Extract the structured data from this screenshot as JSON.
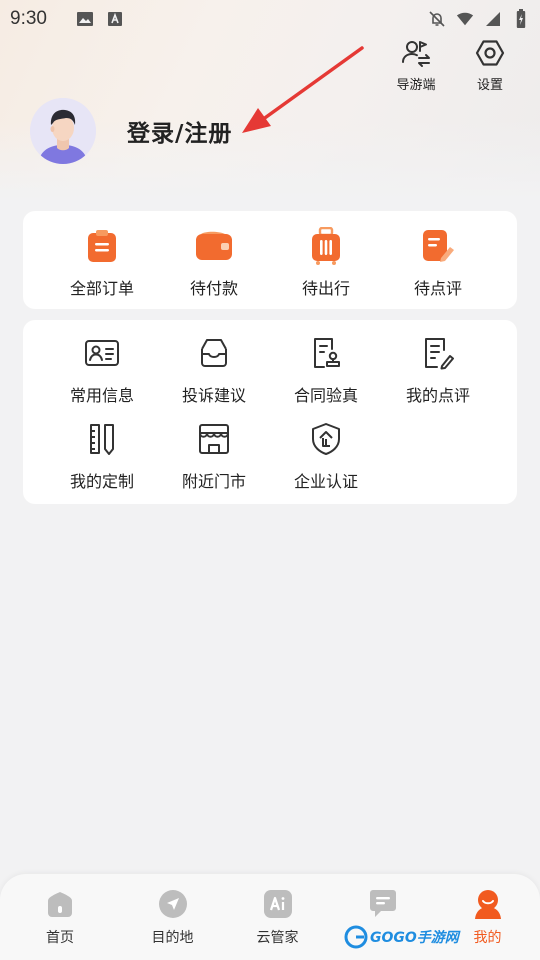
{
  "status_bar": {
    "time": "9:30",
    "left_icons": [
      "image-icon",
      "text-a-icon"
    ],
    "right_icons": [
      "bell-off-icon",
      "wifi-icon",
      "signal-icon",
      "battery-icon"
    ]
  },
  "top_actions": [
    {
      "label": "导游端",
      "icon": "guide-switch-icon"
    },
    {
      "label": "设置",
      "icon": "hexagon-settings-icon"
    }
  ],
  "profile": {
    "login_label": "登录/注册",
    "avatar_icon": "user-avatar"
  },
  "orders": [
    {
      "label": "全部订单",
      "icon": "clipboard-icon"
    },
    {
      "label": "待付款",
      "icon": "wallet-icon"
    },
    {
      "label": "待出行",
      "icon": "suitcase-icon"
    },
    {
      "label": "待点评",
      "icon": "review-pencil-icon"
    }
  ],
  "services": [
    {
      "label": "常用信息",
      "icon": "id-card-icon"
    },
    {
      "label": "投诉建议",
      "icon": "mailbox-icon"
    },
    {
      "label": "合同验真",
      "icon": "contract-stamp-icon"
    },
    {
      "label": "我的点评",
      "icon": "doc-edit-icon"
    },
    {
      "label": "我的定制",
      "icon": "ruler-icon"
    },
    {
      "label": "附近门市",
      "icon": "store-icon"
    },
    {
      "label": "企业认证",
      "icon": "shield-enterprise-icon"
    }
  ],
  "bottom_nav": [
    {
      "label": "首页",
      "icon": "home-icon",
      "active": false
    },
    {
      "label": "目的地",
      "icon": "compass-arrow-icon",
      "active": false
    },
    {
      "label": "云管家",
      "icon": "ai-icon",
      "active": false
    },
    {
      "label": "",
      "icon": "chat-icon",
      "active": false
    },
    {
      "label": "我的",
      "icon": "profile-icon",
      "active": true
    }
  ],
  "watermark": {
    "text": "GOGO手游网"
  },
  "colors": {
    "accent": "#f15a1f",
    "orange_icon": "#f26b2f",
    "text": "#222222",
    "nav_icon_gray": "#bdbdbd",
    "annotation_arrow": "#e53935"
  }
}
